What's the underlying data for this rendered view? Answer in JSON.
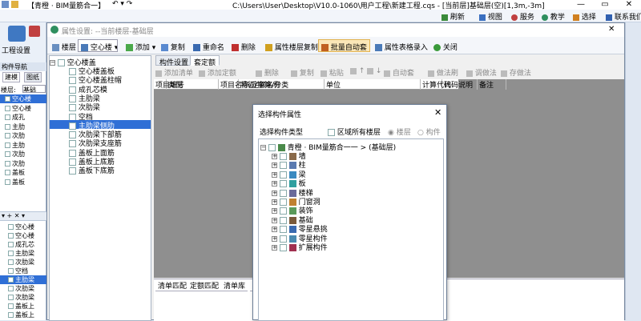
{
  "window": {
    "title": "C:\\Users\\User\\Desktop\\V10.0-1060\\用户工程\\新建工程.cqs - [当前层]基础层(空)[1,3m,-3m]",
    "project_tab": "【青橙 · BIM量筋合一】",
    "controls": [
      "—",
      "▭",
      "✕"
    ]
  },
  "menu": {
    "refresh": "刷新",
    "view": "视图",
    "service": "服务",
    "teach": "教学",
    "skin": "选择",
    "contact": "联系我们"
  },
  "left_ribbon": {
    "project_settings": "工程设置"
  },
  "nav": {
    "title": "构件导航",
    "tabs": [
      "建模",
      "图纸"
    ],
    "floor_label": "楼层:",
    "floor_value": "基础",
    "items_top": [
      "空心楼",
      "空心楼",
      "成孔",
      "主肋",
      "次肋",
      "主肋",
      "次肋",
      "次肋",
      "盖板",
      "盖板"
    ],
    "items_bottom": [
      "空心楼",
      "空心楼",
      "成孔芯",
      "主肋梁",
      "次肋梁",
      "空档",
      "主肋梁",
      "次肋梁",
      "次肋梁",
      "盖板上",
      "盖板上"
    ]
  },
  "dialog": {
    "title": "属性设置: --当前楼层-基础层",
    "close": "✕"
  },
  "toolbar": {
    "floor": "楼层",
    "component": "空心楼",
    "add": "添加",
    "copy": "复制",
    "rename": "重命名",
    "delete": "删除",
    "floor_copy": "属性楼层复制",
    "batch_auto": "批量自动套",
    "table_input": "属性表格录入",
    "close": "关闭"
  },
  "tree": {
    "root": "空心楼盖",
    "items": [
      "空心楼盖板",
      "空心楼盖柱帽",
      "成孔芯模",
      "主肋梁",
      "次肋梁",
      "空档",
      "主肋梁侧肋",
      "次肋梁下部筋",
      "次肋梁支座筋",
      "盖板上面筋",
      "盖板上底筋",
      "盖板下底筋"
    ]
  },
  "right": {
    "tabs": [
      "构件设置",
      "套定额"
    ],
    "grid_toolbar": [
      "添加清单",
      "添加定额",
      "删除",
      "复制",
      "粘贴",
      "↑",
      "↓",
      "自动套",
      "做法刷",
      "调做法",
      "存做法"
    ],
    "grid_headers": [
      "项目编号",
      "类型",
      "项目名称/定额名称",
      "特征/换算/分类",
      "单位",
      "计算代码",
      "代码说明",
      "备注"
    ],
    "bottom_tabs": [
      "清单匹配",
      "定额匹配",
      "清单库",
      "定"
    ]
  },
  "modal": {
    "title": "选择构件属性",
    "type_label": "选择构件类型",
    "all_floors": "区域所有楼层",
    "radio_floor": "楼层",
    "radio_component": "构件",
    "root": "青橙 · BIM量筋合一一 > (基础层)",
    "items": [
      "墙",
      "柱",
      "梁",
      "板",
      "楼梯",
      "门窗洞",
      "装饰",
      "基础",
      "零星悬挑",
      "零星构件",
      "扩展构件"
    ]
  },
  "colors": {
    "selection": "#2f6fd6",
    "highlight": "#fbe7b8",
    "grid_bg": "#8f8f8f"
  }
}
